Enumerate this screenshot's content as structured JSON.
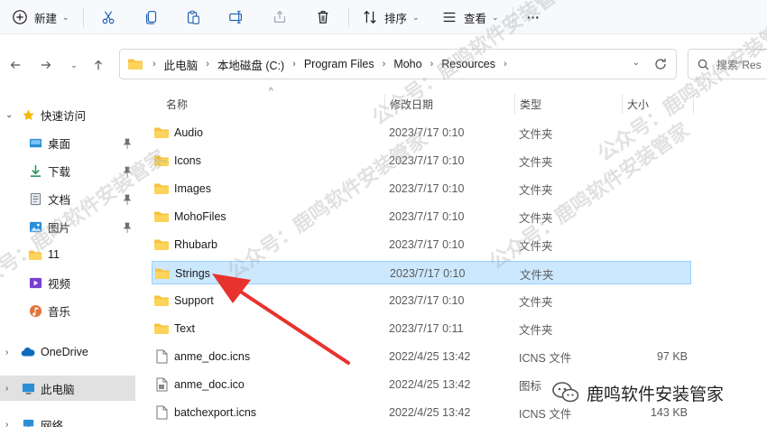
{
  "toolbar": {
    "new_label": "新建",
    "sort_label": "排序",
    "view_label": "查看",
    "more_label": "···"
  },
  "address": {
    "crumbs": [
      "此电脑",
      "本地磁盘 (C:)",
      "Program Files",
      "Moho",
      "Resources"
    ],
    "search_placeholder": "搜索\"Res"
  },
  "sidebar": {
    "items": [
      {
        "label": "快速访问",
        "icon": "star-icon"
      },
      {
        "label": "桌面",
        "icon": "desktop-icon"
      },
      {
        "label": "下载",
        "icon": "download-icon"
      },
      {
        "label": "文档",
        "icon": "document-icon"
      },
      {
        "label": "图片",
        "icon": "picture-icon"
      },
      {
        "label": "11",
        "icon": "folder-icon"
      },
      {
        "label": "视频",
        "icon": "video-icon"
      },
      {
        "label": "音乐",
        "icon": "music-icon"
      },
      {
        "label": "OneDrive",
        "icon": "cloud-icon"
      },
      {
        "label": "此电脑",
        "icon": "computer-icon"
      },
      {
        "label": "网络",
        "icon": "network-icon"
      }
    ]
  },
  "columns": {
    "name": "名称",
    "date": "修改日期",
    "type": "类型",
    "size": "大小"
  },
  "files": [
    {
      "name": "Audio",
      "date": "2023/7/17 0:10",
      "type": "文件夹",
      "size": "",
      "kind": "folder"
    },
    {
      "name": "Icons",
      "date": "2023/7/17 0:10",
      "type": "文件夹",
      "size": "",
      "kind": "folder"
    },
    {
      "name": "Images",
      "date": "2023/7/17 0:10",
      "type": "文件夹",
      "size": "",
      "kind": "folder"
    },
    {
      "name": "MohoFiles",
      "date": "2023/7/17 0:10",
      "type": "文件夹",
      "size": "",
      "kind": "folder"
    },
    {
      "name": "Rhubarb",
      "date": "2023/7/17 0:10",
      "type": "文件夹",
      "size": "",
      "kind": "folder"
    },
    {
      "name": "Strings",
      "date": "2023/7/17 0:10",
      "type": "文件夹",
      "size": "",
      "kind": "folder"
    },
    {
      "name": "Support",
      "date": "2023/7/17 0:10",
      "type": "文件夹",
      "size": "",
      "kind": "folder"
    },
    {
      "name": "Text",
      "date": "2023/7/17 0:11",
      "type": "文件夹",
      "size": "",
      "kind": "folder"
    },
    {
      "name": "anme_doc.icns",
      "date": "2022/4/25 13:42",
      "type": "ICNS 文件",
      "size": "97 KB",
      "kind": "file"
    },
    {
      "name": "anme_doc.ico",
      "date": "2022/4/25 13:42",
      "type": "图标",
      "size": "",
      "kind": "ico"
    },
    {
      "name": "batchexport.icns",
      "date": "2022/4/25 13:42",
      "type": "ICNS 文件",
      "size": "143 KB",
      "kind": "file"
    }
  ],
  "selected_file": "Strings",
  "brand": {
    "text": "鹿鸣软件安装管家"
  },
  "watermark": {
    "text": "公众号：鹿鸣软件安装管家"
  },
  "colors": {
    "folder": "#f8c23f",
    "selected_bg": "#cce8ff",
    "selected_border": "#99d1ff",
    "arrow": "#e8322d"
  }
}
